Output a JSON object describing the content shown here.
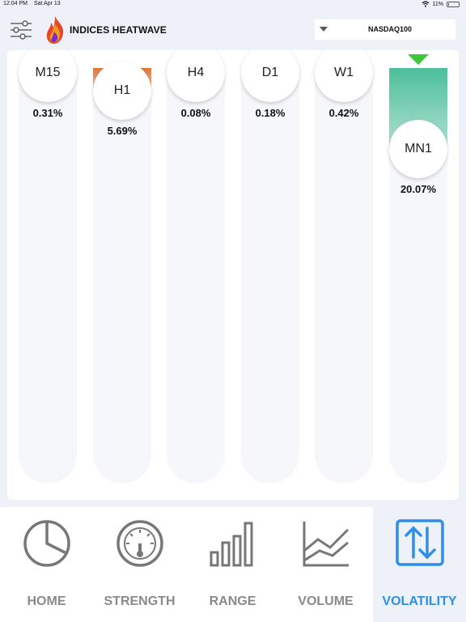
{
  "status_bar": {
    "time": "12:04 PM",
    "date": "Sat Apr 13",
    "battery": "11%",
    "battery_level": 0.11
  },
  "header": {
    "title": "INDICES HEATWAVE",
    "selected_index": "NASDAQ100"
  },
  "colors": {
    "positive": "#4cbf9a",
    "negative": "#e07434",
    "marker": "#3dc83b",
    "active": "#2f8fe8"
  },
  "timeframes": [
    {
      "label": "M15",
      "value": 0.31,
      "display": "0.31%",
      "color": "#4cbf9a",
      "selected": false
    },
    {
      "label": "H1",
      "value": 5.69,
      "display": "5.69%",
      "color": "#e07434",
      "selected": false
    },
    {
      "label": "H4",
      "value": 0.08,
      "display": "0.08%",
      "color": "#4cbf9a",
      "selected": false
    },
    {
      "label": "D1",
      "value": 0.18,
      "display": "0.18%",
      "color": "#4cbf9a",
      "selected": false
    },
    {
      "label": "W1",
      "value": 0.42,
      "display": "0.42%",
      "color": "#4cbf9a",
      "selected": false
    },
    {
      "label": "MN1",
      "value": 20.07,
      "display": "20.07%",
      "color": "#4cbf9a",
      "selected": true
    }
  ],
  "nav": {
    "items": [
      {
        "label": "HOME",
        "icon": "pie-chart-icon"
      },
      {
        "label": "STRENGTH",
        "icon": "speedometer-icon"
      },
      {
        "label": "RANGE",
        "icon": "bar-chart-icon"
      },
      {
        "label": "VOLUME",
        "icon": "line-chart-icon"
      },
      {
        "label": "VOLATILITY",
        "icon": "up-down-arrows-icon"
      }
    ],
    "active": "VOLATILITY"
  }
}
